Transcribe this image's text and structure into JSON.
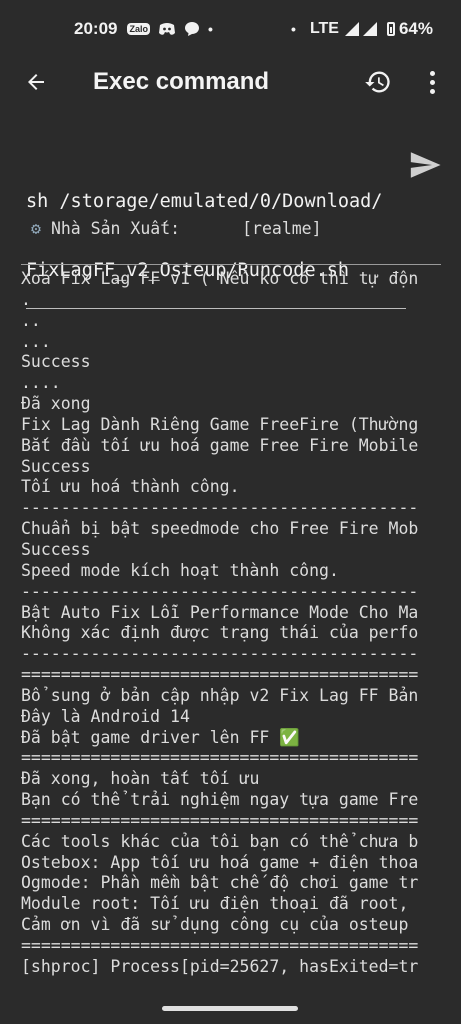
{
  "status_bar": {
    "time": "20:09",
    "zalo_label": "Zalo",
    "network": "LTE",
    "battery": "64%",
    "icons": [
      "zalo-icon",
      "discord-icon",
      "chat-icon",
      "dot-icon",
      "dot-icon",
      "signal-icon",
      "signal-icon",
      "battery-icon"
    ]
  },
  "app_bar": {
    "title": "Exec command",
    "back_icon": "arrow-back-icon",
    "history_icon": "history-icon",
    "menu_icon": "more-vert-icon"
  },
  "command": {
    "line1": "sh /storage/emulated/0/Download/",
    "line2": "FixLagFF_v2_Osteup/Runcode.sh",
    "send_icon": "send-icon"
  },
  "vendor": {
    "label": "Nhà Sản Xuất:",
    "value": "[realme]"
  },
  "output_lines": [
    "Xoá Fix Lag FF v1 ( Nếu ko có thì tự độn",
    ".",
    "..",
    "...",
    "Success",
    "....",
    "Đã xong",
    "Fix Lag Dành Riêng Game FreeFire (Thường",
    "Bắt đầu tối ưu hoá game Free Fire Mobile",
    "Success",
    "Tối ưu hoá thành công.",
    "----------------------------------------",
    "Chuẩn bị bật speedmode cho Free Fire Mob",
    "Success",
    "Speed mode kích hoạt thành công.",
    "----------------------------------------",
    "Bật Auto Fix Lỗi Performance Mode Cho Ma",
    "Không xác định được trạng thái của perfo",
    "----------------------------------------",
    "========================================",
    "Bổ sung ở bản cập nhập v2 Fix Lag FF Bản",
    "Đây là Android 14",
    "Đã bật game driver lên FF ✅",
    "========================================",
    "Đã xong, hoàn tất tối ưu",
    "Bạn có thể trải nghiệm ngay tựa game Fre",
    "========================================",
    "Các tools khác của tôi bạn có thể chưa b",
    "Ostebox: App tối ưu hoá game + điện thoa",
    "Ogmode: Phần mềm bật chế độ chơi game tr",
    "Module root: Tối ưu điện thoại đã root,",
    "Cảm ơn vì đã sử dụng công cụ của osteup",
    "========================================",
    "[shproc] Process[pid=25627, hasExited=tr"
  ],
  "colors": {
    "background": "#2b2b2b",
    "text": "#dcdcdc",
    "accent": "#e0e0e0"
  }
}
